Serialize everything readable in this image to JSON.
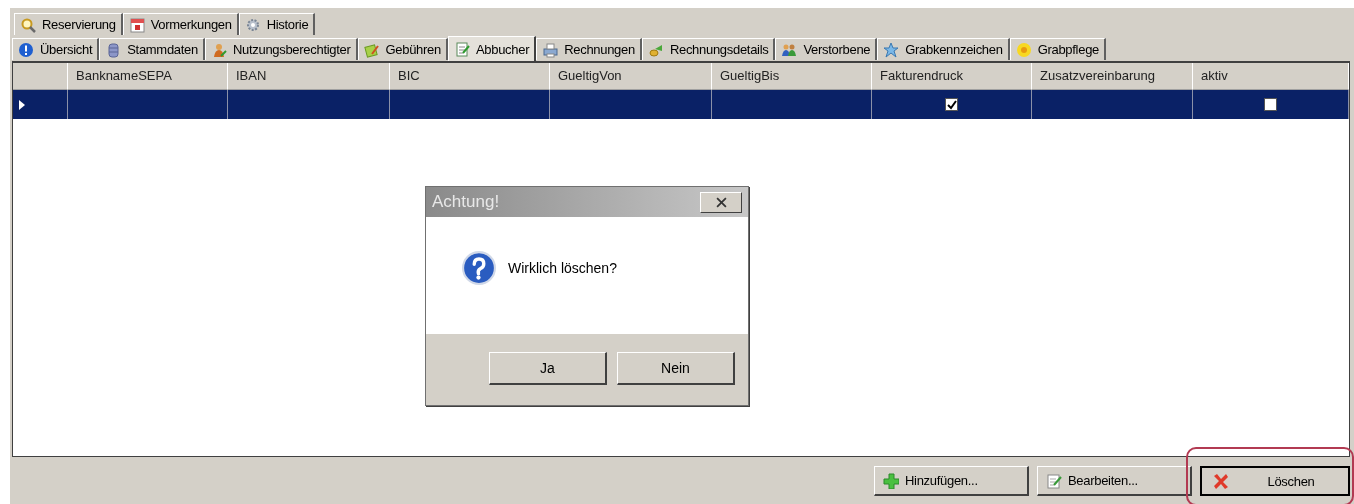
{
  "tab_rows": [
    [
      {
        "label": "Reservierung",
        "kind": "magnifier",
        "selected": false
      },
      {
        "label": "Vormerkungen",
        "kind": "calendar",
        "selected": false
      },
      {
        "label": "Historie",
        "kind": "gear",
        "selected": false
      }
    ],
    [
      {
        "label": "Übersicht",
        "kind": "info",
        "selected": false
      },
      {
        "label": "Stammdaten",
        "kind": "database",
        "selected": false
      },
      {
        "label": "Nutzungsberechtigter",
        "kind": "person",
        "selected": false
      },
      {
        "label": "Gebühren",
        "kind": "notes",
        "selected": false
      },
      {
        "label": "Abbucher",
        "kind": "document",
        "selected": true
      },
      {
        "label": "Rechnungen",
        "kind": "printer",
        "selected": false
      },
      {
        "label": "Rechnungsdetails",
        "kind": "coins",
        "selected": false
      },
      {
        "label": "Verstorbene",
        "kind": "people",
        "selected": false
      },
      {
        "label": "Grabkennzeichen",
        "kind": "star",
        "selected": false
      },
      {
        "label": "Grabpflege",
        "kind": "flower",
        "selected": false
      }
    ]
  ],
  "table": {
    "columns": [
      {
        "label": "BanknameSEPA",
        "kind": "text"
      },
      {
        "label": "IBAN",
        "kind": "text"
      },
      {
        "label": "BIC",
        "kind": "text"
      },
      {
        "label": "GueltigVon",
        "kind": "text"
      },
      {
        "label": "GueltigBis",
        "kind": "text"
      },
      {
        "label": "Fakturendruck",
        "kind": "check"
      },
      {
        "label": "Zusatzvereinbarung",
        "kind": "text"
      },
      {
        "label": "aktiv",
        "kind": "check"
      }
    ],
    "rows": [
      {
        "selected": true,
        "current": true,
        "checkboxes": [
          true,
          false
        ]
      }
    ]
  },
  "dialog": {
    "title": "Achtung!",
    "kind": "question",
    "message": "Wirklich löschen?",
    "buttons": [
      {
        "label": "Ja"
      },
      {
        "label": "Nein"
      }
    ]
  },
  "buttons": [
    {
      "label": "Hinzufügen...",
      "kind": "plus",
      "focused": false,
      "highlighted": false
    },
    {
      "label": "Bearbeiten...",
      "kind": "edit",
      "focused": false,
      "highlighted": false
    },
    {
      "label": "Löschen",
      "kind": "cross",
      "focused": true,
      "highlighted": true
    }
  ]
}
